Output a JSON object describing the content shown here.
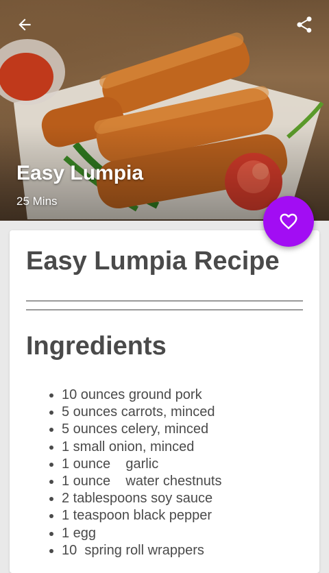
{
  "header": {
    "title": "Easy Lumpia",
    "time": "25 Mins",
    "back_icon": "arrow-back-icon",
    "share_icon": "share-icon"
  },
  "favorite": {
    "icon": "heart-outline-icon",
    "color": "#a20df3"
  },
  "recipe": {
    "title": "Easy Lumpia Recipe",
    "ingredients_heading": "Ingredients",
    "ingredients": [
      "10 ounces ground pork",
      "5 ounces carrots, minced",
      "5 ounces celery, minced",
      "1 small onion, minced",
      "1 ounce    garlic",
      "1 ounce    water chestnuts",
      "2 tablespoons soy sauce",
      "1 teaspoon black pepper",
      "1 egg",
      "10  spring roll wrappers"
    ]
  }
}
